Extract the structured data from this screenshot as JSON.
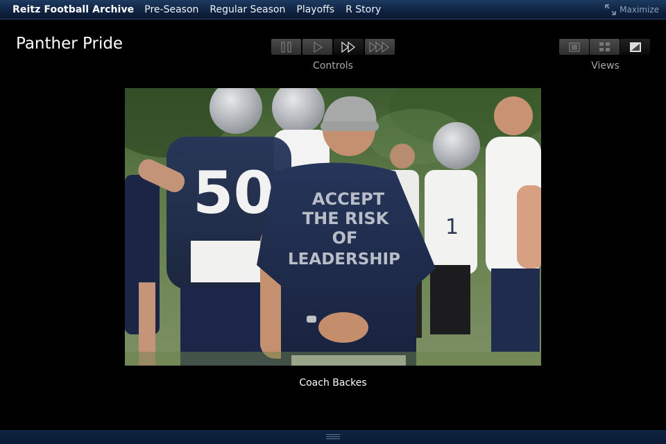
{
  "nav": {
    "brand": "Reitz Football Archive",
    "items": [
      "Pre-Season",
      "Regular Season",
      "Playoffs",
      "R Story"
    ],
    "maximize_label": "Maximize"
  },
  "page": {
    "title": "Panther Pride"
  },
  "controls": {
    "label": "Controls",
    "buttons": [
      "pause-icon",
      "play-icon",
      "fast-forward-icon",
      "fastest-forward-icon"
    ]
  },
  "views": {
    "label": "Views",
    "buttons": [
      "single-view-icon",
      "grid-view-icon",
      "fullscreen-view-icon"
    ]
  },
  "photo": {
    "caption": "Coach Backes",
    "shirt_text": [
      "ACCEPT",
      "THE RISK",
      "OF",
      "LEADERSHIP"
    ],
    "jersey_number": "50"
  },
  "colors": {
    "topbar": "#0f2240",
    "background": "#000000",
    "shirt_navy": "#1e2d4f"
  }
}
